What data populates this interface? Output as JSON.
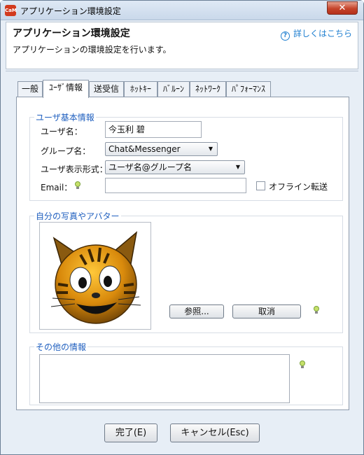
{
  "window": {
    "title": "アプリケーション環境設定",
    "app_icon_text": "CaM",
    "close_symbol": "✕"
  },
  "header": {
    "title": "アプリケーション環境設定",
    "description": "アプリケーションの環境設定を行います。",
    "help_link": "詳しくはこちら",
    "help_icon_symbol": "?"
  },
  "tabs": [
    {
      "label": "一般",
      "active": false
    },
    {
      "label": "ﾕｰｻﾞ情報",
      "active": true
    },
    {
      "label": "送受信",
      "active": false
    },
    {
      "label": "ﾎｯﾄｷｰ",
      "active": false
    },
    {
      "label": "ﾊﾞﾙｰﾝ",
      "active": false
    },
    {
      "label": "ﾈｯﾄﾜｰｸ",
      "active": false
    },
    {
      "label": "ﾊﾟﾌｫｰﾏﾝｽ",
      "active": false
    }
  ],
  "user_info": {
    "group_title": "ユーザ基本情報",
    "username_label": "ユーザ名：",
    "username_value": "今玉利 碧",
    "group_label": "グループ名：",
    "group_value": "Chat&Messenger",
    "display_label": "ユーザ表示形式：",
    "display_value": "ユーザ名@グループ名",
    "email_label": "Email：",
    "email_value": "",
    "offline_label": "オフライン転送",
    "offline_checked": false,
    "dropdown_arrow": "▼"
  },
  "photo": {
    "group_title": "自分の写真やアバター",
    "browse_label": "参照...",
    "cancel_label": "取消"
  },
  "other": {
    "group_title": "その他の情報",
    "value": ""
  },
  "footer": {
    "ok_label": "完了(E)",
    "cancel_label": "キャンセル(Esc)"
  },
  "colors": {
    "accent_blue": "#1f5fbf",
    "link_blue": "#1f7fd0",
    "close_red": "#c5442a"
  }
}
